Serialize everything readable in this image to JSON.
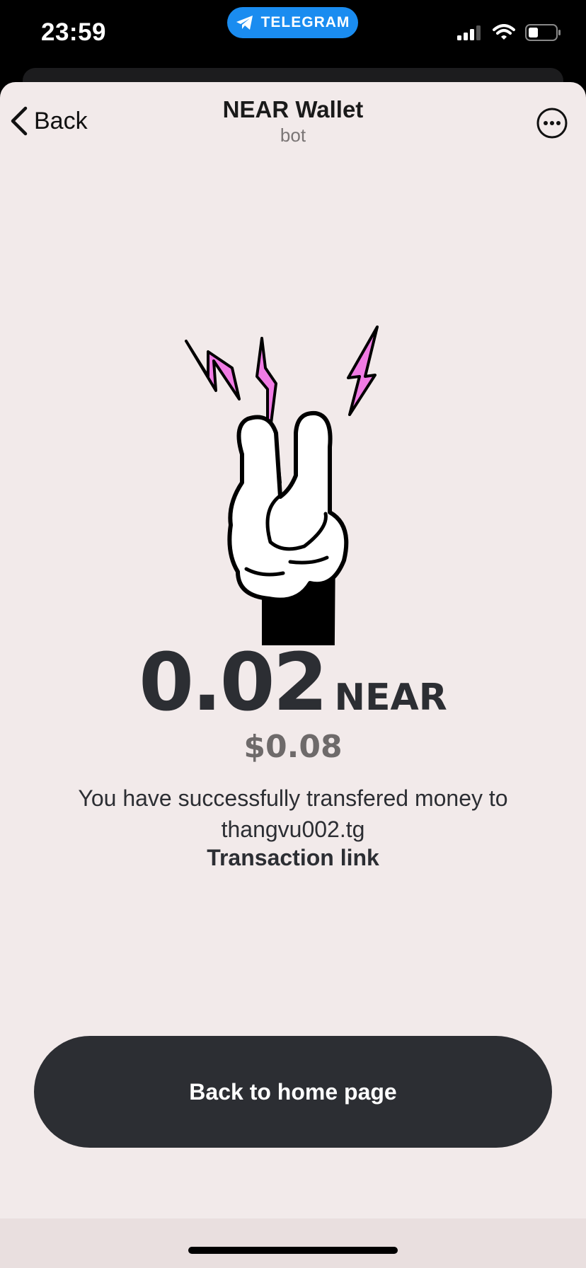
{
  "status_bar": {
    "time": "23:59",
    "telegram_label": "TELEGRAM"
  },
  "header": {
    "back_label": "Back",
    "title": "NEAR Wallet",
    "subtitle": "bot"
  },
  "result": {
    "amount": "0.02",
    "unit": "NEAR",
    "usd_value": "$0.08",
    "message": "You have successfully transfered money to thangvu002.tg",
    "link_label": "Transaction link"
  },
  "actions": {
    "home_label": "Back to home page"
  },
  "colors": {
    "background": "#f2eaea",
    "primary_button": "#2c2e33",
    "telegram_blue": "#1a8cf0",
    "bolt_pink": "#f07be4"
  }
}
